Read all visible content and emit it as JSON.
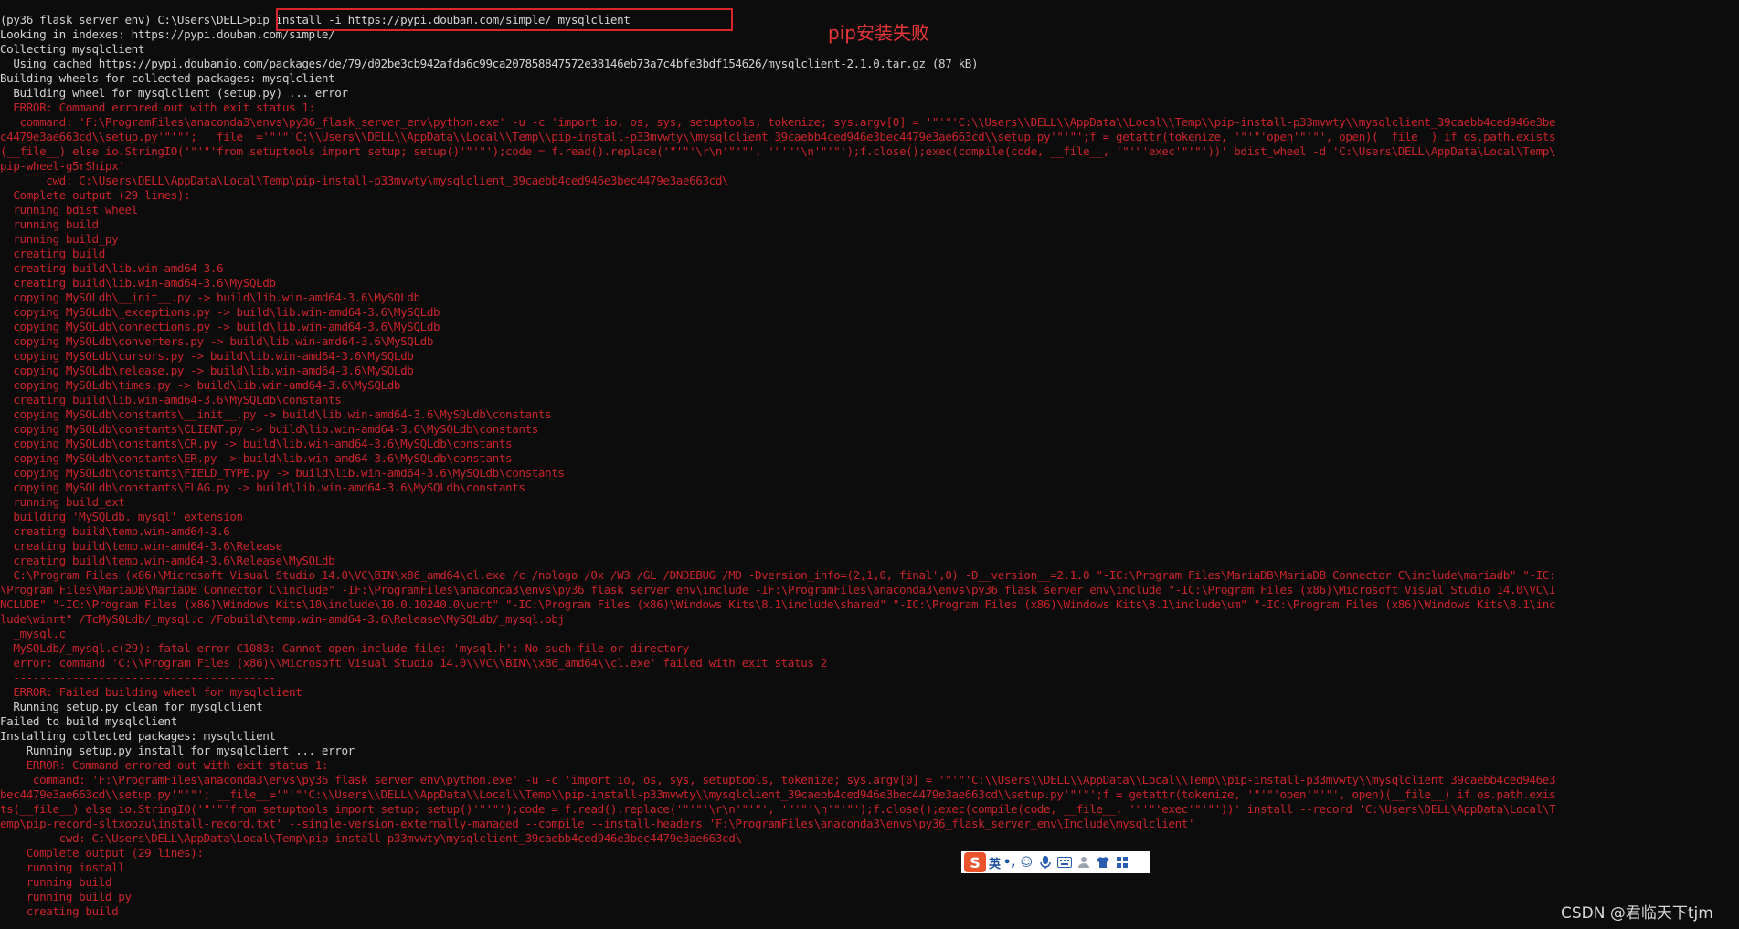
{
  "terminal": {
    "lines": [
      {
        "c": "w",
        "t": "(py36_flask_server_env) C:\\Users\\DELL>pip install -i https://pypi.douban.com/simple/ mysqlclient"
      },
      {
        "c": "w",
        "t": "Looking in indexes: https://pypi.douban.com/simple/"
      },
      {
        "c": "w",
        "t": "Collecting mysqlclient"
      },
      {
        "c": "w",
        "t": "  Using cached https://pypi.doubanio.com/packages/de/79/d02be3cb942afda6c99ca207858847572e38146eb73a7c4bfe3bdf154626/mysqlclient-2.1.0.tar.gz (87 kB)"
      },
      {
        "c": "w",
        "t": "Building wheels for collected packages: mysqlclient"
      },
      {
        "c": "w",
        "t": "  Building wheel for mysqlclient (setup.py) ... error"
      },
      {
        "c": "r",
        "t": "  ERROR: Command errored out with exit status 1:"
      },
      {
        "c": "r",
        "t": "   command: 'F:\\ProgramFiles\\anaconda3\\envs\\py36_flask_server_env\\python.exe' -u -c 'import io, os, sys, setuptools, tokenize; sys.argv[0] = '\"'\"'C:\\\\Users\\\\DELL\\\\AppData\\\\Local\\\\Temp\\\\pip-install-p33mvwty\\\\mysqlclient_39caebb4ced946e3be"
      },
      {
        "c": "r",
        "t": "c4479e3ae663cd\\\\setup.py'\"'\"'; __file__='\"'\"'C:\\\\Users\\\\DELL\\\\AppData\\\\Local\\\\Temp\\\\pip-install-p33mvwty\\\\mysqlclient_39caebb4ced946e3bec4479e3ae663cd\\\\setup.py'\"'\"';f = getattr(tokenize, '\"'\"'open'\"'\"', open)(__file__) if os.path.exists"
      },
      {
        "c": "r",
        "t": "(__file__) else io.StringIO('\"'\"'from setuptools import setup; setup()'\"'\"');code = f.read().replace('\"'\"'\\r\\n'\"'\"', '\"'\"'\\n'\"'\"');f.close();exec(compile(code, __file__, '\"'\"'exec'\"'\"'))' bdist_wheel -d 'C:\\Users\\DELL\\AppData\\Local\\Temp\\"
      },
      {
        "c": "r",
        "t": "pip-wheel-g5rShipx'"
      },
      {
        "c": "r",
        "t": "       cwd: C:\\Users\\DELL\\AppData\\Local\\Temp\\pip-install-p33mvwty\\mysqlclient_39caebb4ced946e3bec4479e3ae663cd\\"
      },
      {
        "c": "r",
        "t": "  Complete output (29 lines):"
      },
      {
        "c": "r",
        "t": "  running bdist_wheel"
      },
      {
        "c": "r",
        "t": "  running build"
      },
      {
        "c": "r",
        "t": "  running build_py"
      },
      {
        "c": "r",
        "t": "  creating build"
      },
      {
        "c": "r",
        "t": "  creating build\\lib.win-amd64-3.6"
      },
      {
        "c": "r",
        "t": "  creating build\\lib.win-amd64-3.6\\MySQLdb"
      },
      {
        "c": "r",
        "t": "  copying MySQLdb\\__init__.py -> build\\lib.win-amd64-3.6\\MySQLdb"
      },
      {
        "c": "r",
        "t": "  copying MySQLdb\\_exceptions.py -> build\\lib.win-amd64-3.6\\MySQLdb"
      },
      {
        "c": "r",
        "t": "  copying MySQLdb\\connections.py -> build\\lib.win-amd64-3.6\\MySQLdb"
      },
      {
        "c": "r",
        "t": "  copying MySQLdb\\converters.py -> build\\lib.win-amd64-3.6\\MySQLdb"
      },
      {
        "c": "r",
        "t": "  copying MySQLdb\\cursors.py -> build\\lib.win-amd64-3.6\\MySQLdb"
      },
      {
        "c": "r",
        "t": "  copying MySQLdb\\release.py -> build\\lib.win-amd64-3.6\\MySQLdb"
      },
      {
        "c": "r",
        "t": "  copying MySQLdb\\times.py -> build\\lib.win-amd64-3.6\\MySQLdb"
      },
      {
        "c": "r",
        "t": "  creating build\\lib.win-amd64-3.6\\MySQLdb\\constants"
      },
      {
        "c": "r",
        "t": "  copying MySQLdb\\constants\\__init__.py -> build\\lib.win-amd64-3.6\\MySQLdb\\constants"
      },
      {
        "c": "r",
        "t": "  copying MySQLdb\\constants\\CLIENT.py -> build\\lib.win-amd64-3.6\\MySQLdb\\constants"
      },
      {
        "c": "r",
        "t": "  copying MySQLdb\\constants\\CR.py -> build\\lib.win-amd64-3.6\\MySQLdb\\constants"
      },
      {
        "c": "r",
        "t": "  copying MySQLdb\\constants\\ER.py -> build\\lib.win-amd64-3.6\\MySQLdb\\constants"
      },
      {
        "c": "r",
        "t": "  copying MySQLdb\\constants\\FIELD_TYPE.py -> build\\lib.win-amd64-3.6\\MySQLdb\\constants"
      },
      {
        "c": "r",
        "t": "  copying MySQLdb\\constants\\FLAG.py -> build\\lib.win-amd64-3.6\\MySQLdb\\constants"
      },
      {
        "c": "r",
        "t": "  running build_ext"
      },
      {
        "c": "r",
        "t": "  building 'MySQLdb._mysql' extension"
      },
      {
        "c": "r",
        "t": "  creating build\\temp.win-amd64-3.6"
      },
      {
        "c": "r",
        "t": "  creating build\\temp.win-amd64-3.6\\Release"
      },
      {
        "c": "r",
        "t": "  creating build\\temp.win-amd64-3.6\\Release\\MySQLdb"
      },
      {
        "c": "r",
        "t": "  C:\\Program Files (x86)\\Microsoft Visual Studio 14.0\\VC\\BIN\\x86_amd64\\cl.exe /c /nologo /Ox /W3 /GL /DNDEBUG /MD -Dversion_info=(2,1,0,'final',0) -D__version__=2.1.0 \"-IC:\\Program Files\\MariaDB\\MariaDB Connector C\\include\\mariadb\" \"-IC:"
      },
      {
        "c": "r",
        "t": "\\Program Files\\MariaDB\\MariaDB Connector C\\include\" -IF:\\ProgramFiles\\anaconda3\\envs\\py36_flask_server_env\\include -IF:\\ProgramFiles\\anaconda3\\envs\\py36_flask_server_env\\include \"-IC:\\Program Files (x86)\\Microsoft Visual Studio 14.0\\VC\\I"
      },
      {
        "c": "r",
        "t": "NCLUDE\" \"-IC:\\Program Files (x86)\\Windows Kits\\10\\include\\10.0.10240.0\\ucrt\" \"-IC:\\Program Files (x86)\\Windows Kits\\8.1\\include\\shared\" \"-IC:\\Program Files (x86)\\Windows Kits\\8.1\\include\\um\" \"-IC:\\Program Files (x86)\\Windows Kits\\8.1\\inc"
      },
      {
        "c": "r",
        "t": "lude\\winrt\" /TcMySQLdb/_mysql.c /Fobuild\\temp.win-amd64-3.6\\Release\\MySQLdb/_mysql.obj"
      },
      {
        "c": "r",
        "t": "  _mysql.c"
      },
      {
        "c": "r",
        "t": "  MySQLdb/_mysql.c(29): fatal error C1083: Cannot open include file: 'mysql.h': No such file or directory"
      },
      {
        "c": "r",
        "t": "  error: command 'C:\\\\Program Files (x86)\\\\Microsoft Visual Studio 14.0\\\\VC\\\\BIN\\\\x86_amd64\\\\cl.exe' failed with exit status 2"
      },
      {
        "c": "r",
        "t": "  ----------------------------------------"
      },
      {
        "c": "r",
        "t": "  ERROR: Failed building wheel for mysqlclient"
      },
      {
        "c": "w",
        "t": "  Running setup.py clean for mysqlclient"
      },
      {
        "c": "w",
        "t": "Failed to build mysqlclient"
      },
      {
        "c": "w",
        "t": "Installing collected packages: mysqlclient"
      },
      {
        "c": "w",
        "t": "    Running setup.py install for mysqlclient ... error"
      },
      {
        "c": "r",
        "t": "    ERROR: Command errored out with exit status 1:"
      },
      {
        "c": "r",
        "t": "     command: 'F:\\ProgramFiles\\anaconda3\\envs\\py36_flask_server_env\\python.exe' -u -c 'import io, os, sys, setuptools, tokenize; sys.argv[0] = '\"'\"'C:\\\\Users\\\\DELL\\\\AppData\\\\Local\\\\Temp\\\\pip-install-p33mvwty\\\\mysqlclient_39caebb4ced946e3"
      },
      {
        "c": "r",
        "t": "bec4479e3ae663cd\\\\setup.py'\"'\"'; __file__='\"'\"'C:\\\\Users\\\\DELL\\\\AppData\\\\Local\\\\Temp\\\\pip-install-p33mvwty\\\\mysqlclient_39caebb4ced946e3bec4479e3ae663cd\\\\setup.py'\"'\"';f = getattr(tokenize, '\"'\"'open'\"'\"', open)(__file__) if os.path.exis"
      },
      {
        "c": "r",
        "t": "ts(__file__) else io.StringIO('\"'\"'from setuptools import setup; setup()'\"'\"');code = f.read().replace('\"'\"'\\r\\n'\"'\"', '\"'\"'\\n'\"'\"');f.close();exec(compile(code, __file__, '\"'\"'exec'\"'\"'))' install --record 'C:\\Users\\DELL\\AppData\\Local\\T"
      },
      {
        "c": "r",
        "t": "emp\\pip-record-sltxoozu\\install-record.txt' --single-version-externally-managed --compile --install-headers 'F:\\ProgramFiles\\anaconda3\\envs\\py36_flask_server_env\\Include\\mysqlclient'"
      },
      {
        "c": "r",
        "t": "         cwd: C:\\Users\\DELL\\AppData\\Local\\Temp\\pip-install-p33mvwty\\mysqlclient_39caebb4ced946e3bec4479e3ae663cd\\"
      },
      {
        "c": "r",
        "t": "    Complete output (29 lines):"
      },
      {
        "c": "r",
        "t": "    running install"
      },
      {
        "c": "r",
        "t": "    running build"
      },
      {
        "c": "r",
        "t": "    running build_py"
      },
      {
        "c": "r",
        "t": "    creating build"
      }
    ]
  },
  "annotation": {
    "text": "pip安装失败",
    "color": "#e8363a"
  },
  "ime_toolbar": {
    "logo": "S",
    "lang_label": "英",
    "punct_label": "•,",
    "icons": [
      "emoji-icon",
      "microphone-icon",
      "keyboard-icon",
      "user-icon",
      "shirt-icon",
      "grid-icon"
    ]
  },
  "watermark": {
    "text": "CSDN @君临天下tjm"
  },
  "colors": {
    "background": "#0c0c0c",
    "normal_text": "#d2d2d2",
    "error_text": "#c7242b",
    "highlight_box": "#d9262c"
  }
}
